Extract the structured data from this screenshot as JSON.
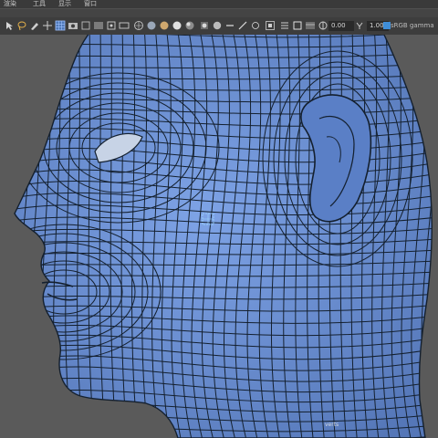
{
  "menubar": {
    "items": [
      {
        "label": "渲染"
      },
      {
        "label": "工具"
      },
      {
        "label": "显示"
      },
      {
        "label": "窗口"
      }
    ]
  },
  "statusline": {
    "camera_value": "0.00",
    "resolution_value": "1.00",
    "camera_label": "sRGB gamma"
  },
  "viewport": {
    "hud_label": "verts",
    "mesh_color": "#6b93d6",
    "wire_color": "#15202f",
    "background": "#5a5a5a"
  },
  "icons": [
    "select-tool-icon",
    "lasso-tool-icon",
    "paint-tool-icon",
    "grid-icon",
    "wireframe-icon",
    "smooth-shade-icon",
    "texture-icon",
    "light-icon",
    "shadow-icon",
    "xray-icon",
    "isolate-icon",
    "camera-icon"
  ]
}
